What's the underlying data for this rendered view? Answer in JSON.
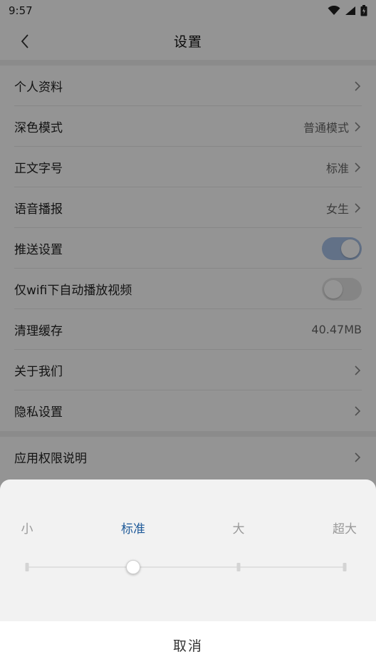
{
  "status": {
    "time": "9:57"
  },
  "header": {
    "title": "设置"
  },
  "settings": {
    "items": [
      {
        "label": "个人资料"
      },
      {
        "label": "深色模式",
        "value": "普通模式"
      },
      {
        "label": "正文字号",
        "value": "标准"
      },
      {
        "label": "语音播报",
        "value": "女生"
      },
      {
        "label": "推送设置",
        "toggle": "on"
      },
      {
        "label": "仅wifi下自动播放视频",
        "toggle": "off"
      },
      {
        "label": "清理缓存",
        "value": "40.47MB"
      },
      {
        "label": "关于我们"
      },
      {
        "label": "隐私设置"
      },
      {
        "label": "应用权限说明"
      }
    ]
  },
  "font_size_sheet": {
    "options": [
      "小",
      "标准",
      "大",
      "超大"
    ],
    "selected": "标准",
    "selected_index": 1,
    "cancel_label": "取消"
  },
  "colors": {
    "accent": "#1f5a99",
    "toggle_on": "#4a6fa5"
  }
}
